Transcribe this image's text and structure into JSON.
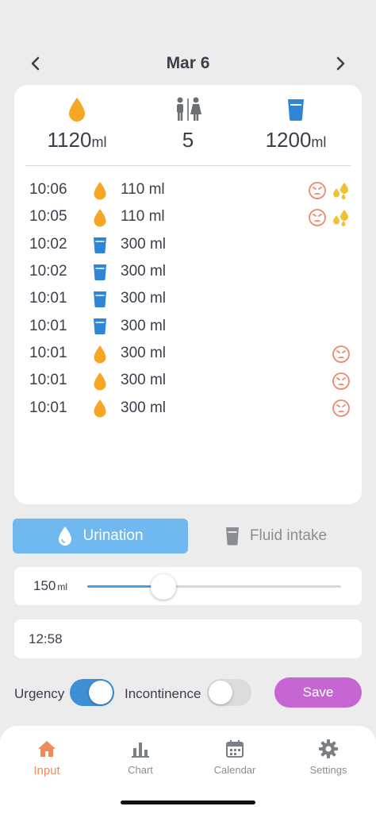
{
  "header": {
    "date": "Mar 6"
  },
  "summary": {
    "urination_total": "1120",
    "urination_unit": "ml",
    "toilet_count": "5",
    "fluid_total": "1200",
    "fluid_unit": "ml"
  },
  "colors": {
    "urine": "#f5a623",
    "fluid": "#2f86d8",
    "flag": "#f0866a",
    "leak": "#f2c12e",
    "save": "#c566d2",
    "tab_active": "#ef8a5d"
  },
  "log": [
    {
      "time": "10:06",
      "kind": "urination",
      "amount": "110 ml",
      "urgency": true,
      "leak": true
    },
    {
      "time": "10:05",
      "kind": "urination",
      "amount": "110 ml",
      "urgency": true,
      "leak": true
    },
    {
      "time": "10:02",
      "kind": "fluid",
      "amount": "300 ml",
      "urgency": false,
      "leak": false
    },
    {
      "time": "10:02",
      "kind": "fluid",
      "amount": "300 ml",
      "urgency": false,
      "leak": false
    },
    {
      "time": "10:01",
      "kind": "fluid",
      "amount": "300 ml",
      "urgency": false,
      "leak": false
    },
    {
      "time": "10:01",
      "kind": "fluid",
      "amount": "300 ml",
      "urgency": false,
      "leak": false
    },
    {
      "time": "10:01",
      "kind": "urination",
      "amount": "300 ml",
      "urgency": true,
      "leak": false
    },
    {
      "time": "10:01",
      "kind": "urination",
      "amount": "300 ml",
      "urgency": true,
      "leak": false
    },
    {
      "time": "10:01",
      "kind": "urination",
      "amount": "300 ml",
      "urgency": true,
      "leak": false
    }
  ],
  "mode": {
    "urination_label": "Urination",
    "fluid_label": "Fluid intake",
    "selected": "urination"
  },
  "volume": {
    "value": "150",
    "unit": "ml",
    "fraction": 0.3
  },
  "time_field": {
    "value": "12:58"
  },
  "controls": {
    "urgency_label": "Urgency",
    "urgency_on": true,
    "incontinence_label": "Incontinence",
    "incontinence_on": false,
    "save_label": "Save"
  },
  "tabs": [
    {
      "label": "Input",
      "icon": "home-icon",
      "active": true
    },
    {
      "label": "Chart",
      "icon": "bar-chart-icon",
      "active": false
    },
    {
      "label": "Calendar",
      "icon": "calendar-icon",
      "active": false
    },
    {
      "label": "Settings",
      "icon": "gear-icon",
      "active": false
    }
  ]
}
